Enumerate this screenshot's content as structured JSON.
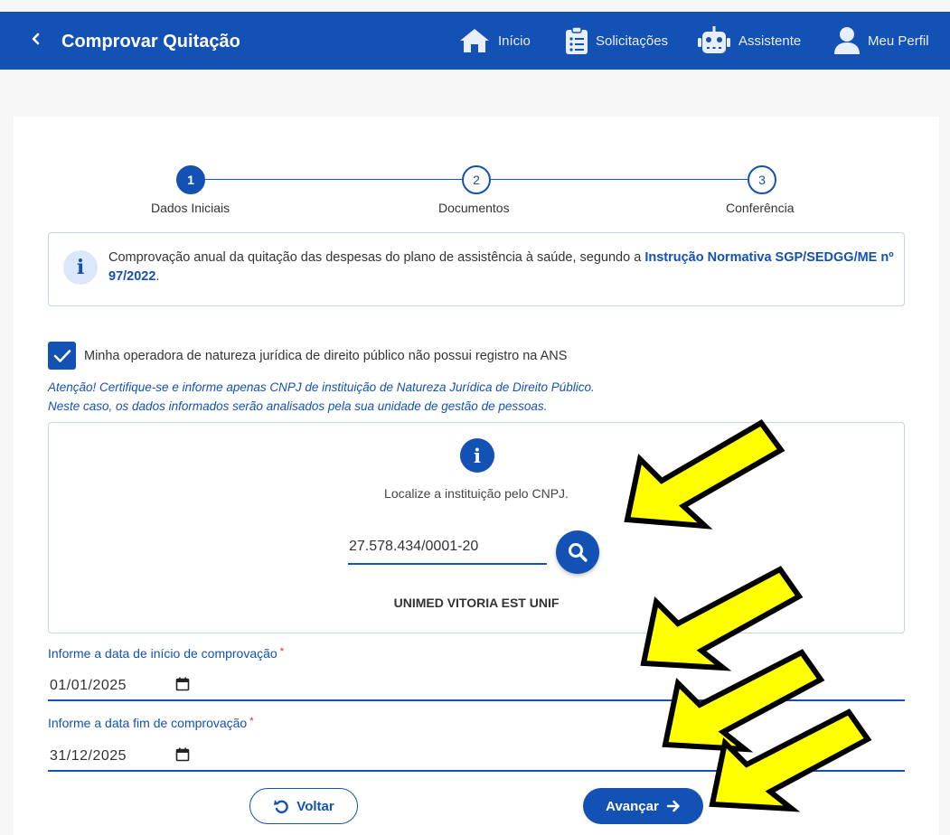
{
  "header": {
    "back_icon": "chevron-left-icon",
    "title": "Comprovar Quitação",
    "nav": [
      {
        "label": "Início",
        "icon": "home-icon"
      },
      {
        "label": "Solicitações",
        "icon": "clipboard-list-icon"
      },
      {
        "label": "Assistente",
        "icon": "robot-icon"
      },
      {
        "label": "Meu Perfil",
        "icon": "user-icon"
      }
    ],
    "color": "#1351b4"
  },
  "stepper": {
    "steps": [
      {
        "number": "1",
        "label": "Dados Iniciais",
        "active": true
      },
      {
        "number": "2",
        "label": "Documentos",
        "active": false
      },
      {
        "number": "3",
        "label": "Conferência",
        "active": false
      }
    ]
  },
  "info_box": {
    "icon": "info-icon",
    "text": "Comprovação anual da quitação das despesas do plano de assistência à saúde, segundo a ",
    "link": "Instrução Normativa SGP/SEDGG/ME nº 97/2022",
    "suffix": "."
  },
  "checkbox": {
    "checked": true,
    "label": "Minha operadora de natureza jurídica de direito público não possui registro na ANS"
  },
  "warning": {
    "line1": "Atenção! Certifique-se e informe apenas CNPJ de instituição de Natureza Jurídica de Direito Público.",
    "line2": "Neste caso, os dados informados serão analisados pela sua unidade de gestão de pessoas."
  },
  "search": {
    "icon": "info-icon",
    "hint": "Localize a instituição pelo CNPJ.",
    "cnpj_value": "27.578.434/0001-20",
    "button_icon": "search-icon",
    "result": "UNIMED VITORIA EST UNIF"
  },
  "start_date": {
    "label": "Informe a data de início de comprovação",
    "required_mark": "*",
    "value": "01/01/2025",
    "icon": "calendar-icon"
  },
  "end_date": {
    "label": "Informe a data fim de comprovação",
    "required_mark": "*",
    "value": "31/12/2025",
    "icon": "calendar-icon"
  },
  "actions": {
    "back_label": "Voltar",
    "back_icon": "undo-icon",
    "next_label": "Avançar",
    "next_icon": "arrow-right-icon"
  },
  "annotation_arrow_color": "#ffff00"
}
